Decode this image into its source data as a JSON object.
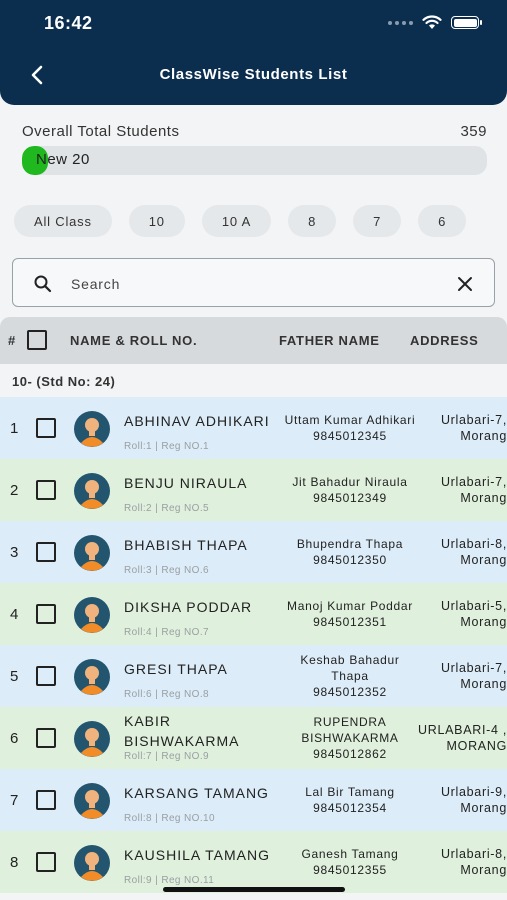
{
  "status_bar": {
    "time": "16:42"
  },
  "header": {
    "title": "ClassWise Students List"
  },
  "summary": {
    "label": "Overall Total Students",
    "total": "359",
    "progress_label": "New 20",
    "progress_fraction": 0.056
  },
  "filters": [
    "All Class",
    "10",
    "10 A",
    "8",
    "7",
    "6"
  ],
  "search": {
    "placeholder": "Search"
  },
  "table": {
    "headers": {
      "index": "#",
      "name": "NAME & ROLL NO.",
      "father": "FATHER NAME",
      "address": "ADDRESS"
    },
    "group_label": "10- (Std No: 24)",
    "rows": [
      {
        "index": "1",
        "name": "ABHINAV ADHIKARI",
        "meta": "Roll:1 | Reg NO.1",
        "father": "Uttam Kumar Adhikari",
        "phone": "9845012345",
        "address": "Urlabari-7, Morang"
      },
      {
        "index": "2",
        "name": "BENJU NIRAULA",
        "meta": "Roll:2 | Reg NO.5",
        "father": "Jit Bahadur Niraula",
        "phone": "9845012349",
        "address": "Urlabari-7, Morang"
      },
      {
        "index": "3",
        "name": "BHABISH THAPA",
        "meta": "Roll:3 | Reg NO.6",
        "father": "Bhupendra Thapa",
        "phone": "9845012350",
        "address": "Urlabari-8, Morang"
      },
      {
        "index": "4",
        "name": "DIKSHA PODDAR",
        "meta": "Roll:4 | Reg NO.7",
        "father": "Manoj Kumar Poddar",
        "phone": "9845012351",
        "address": "Urlabari-5, Morang"
      },
      {
        "index": "5",
        "name": "GRESI THAPA",
        "meta": "Roll:6 | Reg NO.8",
        "father": "Keshab Bahadur Thapa",
        "phone": "9845012352",
        "address": "Urlabari-7, Morang"
      },
      {
        "index": "6",
        "name": "KABIR BISHWAKARMA",
        "meta": "Roll:7 | Reg NO.9",
        "father": "RUPENDRA BISHWAKARMA",
        "phone": "9845012862",
        "address": "URLABARI-4 , MORANG"
      },
      {
        "index": "7",
        "name": "KARSANG TAMANG",
        "meta": "Roll:8 | Reg NO.10",
        "father": "Lal Bir Tamang",
        "phone": "9845012354",
        "address": "Urlabari-9, Morang"
      },
      {
        "index": "8",
        "name": "KAUSHILA TAMANG",
        "meta": "Roll:9 | Reg NO.11",
        "father": "Ganesh Tamang",
        "phone": "9845012355",
        "address": "Urlabari-8, Morang"
      }
    ]
  },
  "colors": {
    "header_bg": "#0b2e4f",
    "progress_fill": "#1fb81f",
    "row_blue": "#dcecf8",
    "row_green": "#dff0dc",
    "avatar_bg": "#24556e",
    "avatar_skin": "#f0b37e",
    "avatar_shirt": "#f28c28"
  },
  "icons": {
    "back": "chevron-left-icon",
    "search": "search-icon",
    "clear": "close-icon",
    "avatar": "student-avatar-icon",
    "wifi": "wifi-icon",
    "battery": "battery-icon",
    "signal": "signal-icon"
  }
}
